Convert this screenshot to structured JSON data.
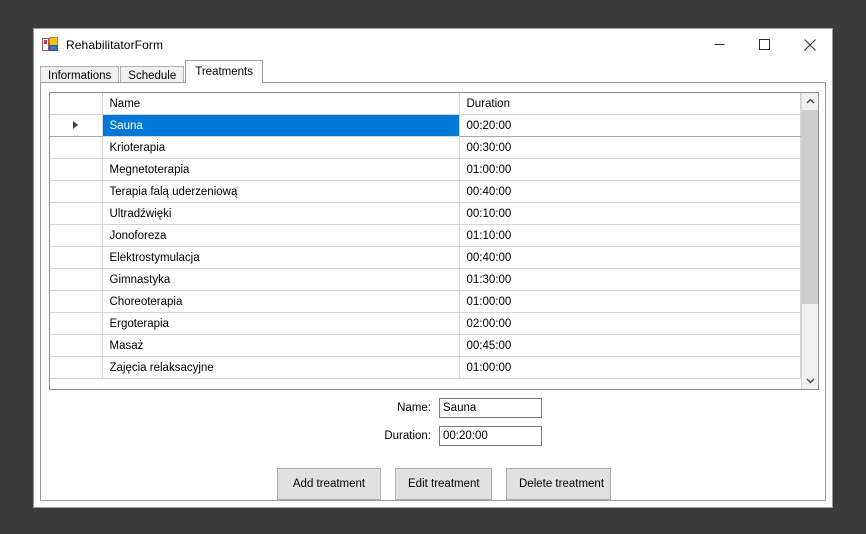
{
  "window": {
    "title": "RehabilitatorForm",
    "icon": "winforms-app-icon",
    "controls": {
      "minimize": "minimize-icon",
      "maximize": "maximize-icon",
      "close": "close-icon"
    }
  },
  "tabs": [
    {
      "label": "Informations",
      "active": false
    },
    {
      "label": "Schedule",
      "active": false
    },
    {
      "label": "Treatments",
      "active": true
    }
  ],
  "grid": {
    "columns": [
      "",
      "Name",
      "Duration"
    ],
    "selected_row_index": 0,
    "row_indicator": "row-select-caret-icon",
    "rows": [
      {
        "name": "Sauna",
        "duration": "00:20:00"
      },
      {
        "name": "Krioterapia",
        "duration": "00:30:00"
      },
      {
        "name": "Megnetoterapia",
        "duration": "01:00:00"
      },
      {
        "name": "Terapia falą uderzeniową",
        "duration": "00:40:00"
      },
      {
        "name": "Ultradźwięki",
        "duration": "00:10:00"
      },
      {
        "name": "Jonoforeza",
        "duration": "01:10:00"
      },
      {
        "name": "Elektrostymulacja",
        "duration": "00:40:00"
      },
      {
        "name": "Gimnastyka",
        "duration": "01:30:00"
      },
      {
        "name": "Choreoterapia",
        "duration": "01:00:00"
      },
      {
        "name": "Ergoterapia",
        "duration": "02:00:00"
      },
      {
        "name": "Masaż",
        "duration": "00:45:00"
      },
      {
        "name": "Zajęcia relaksacyjne",
        "duration": "01:00:00"
      }
    ],
    "scrollbar": {
      "up_arrow": "chevron-up-icon",
      "down_arrow": "chevron-down-icon",
      "thumb_fraction": 0.74
    }
  },
  "form": {
    "name_label": "Name:",
    "name_value": "Sauna",
    "duration_label": "Duration:",
    "duration_value": "00:20:00"
  },
  "buttons": {
    "add": "Add treatment",
    "edit": "Edit treatment",
    "delete": "Delete treatment"
  },
  "colors": {
    "selection": "#0078d7",
    "desktop": "#3b3b3b",
    "button_face": "#e1e1e1",
    "tab_inactive": "#f0f0f0"
  }
}
